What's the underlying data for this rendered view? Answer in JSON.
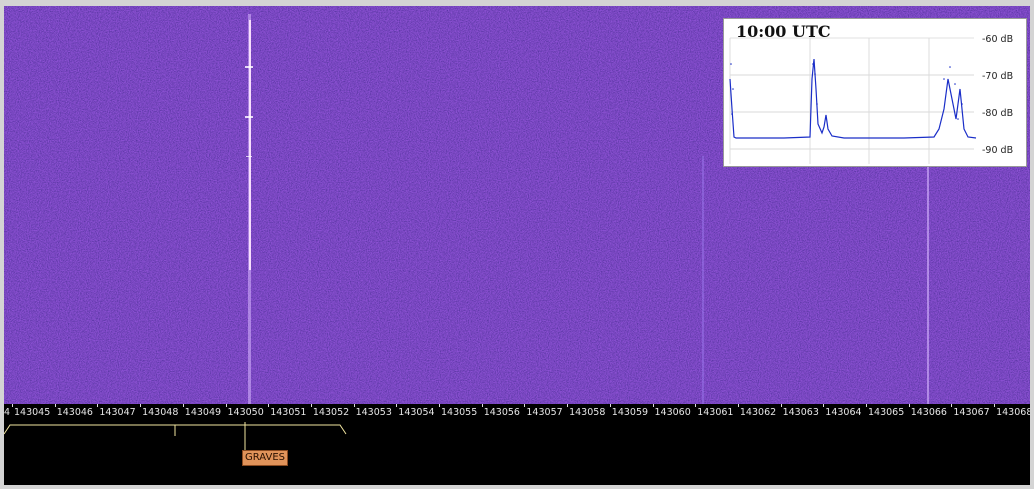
{
  "window": {
    "colors": {
      "waterfall_bg": "#3a1c8c",
      "signal": "#ffe6ff",
      "band_marker": "#f5e8a0",
      "label_bg": "#e0935a"
    }
  },
  "scale": {
    "leading_fragment": "4",
    "ticks": [
      "143045",
      "143046",
      "143047",
      "143048",
      "143049",
      "143050",
      "143051",
      "143052",
      "143053",
      "143054",
      "143055",
      "143056",
      "143057",
      "143058",
      "143059",
      "143060",
      "143061",
      "143062",
      "143063",
      "143064",
      "143065",
      "143066",
      "143067",
      "143068"
    ]
  },
  "marker": {
    "label": "GRAVES",
    "frequency": "143050"
  },
  "spectrum": {
    "time": "10:00 UTC",
    "db_labels": [
      "-60 dB",
      "-70 dB",
      "-80 dB",
      "-90 dB"
    ]
  }
}
